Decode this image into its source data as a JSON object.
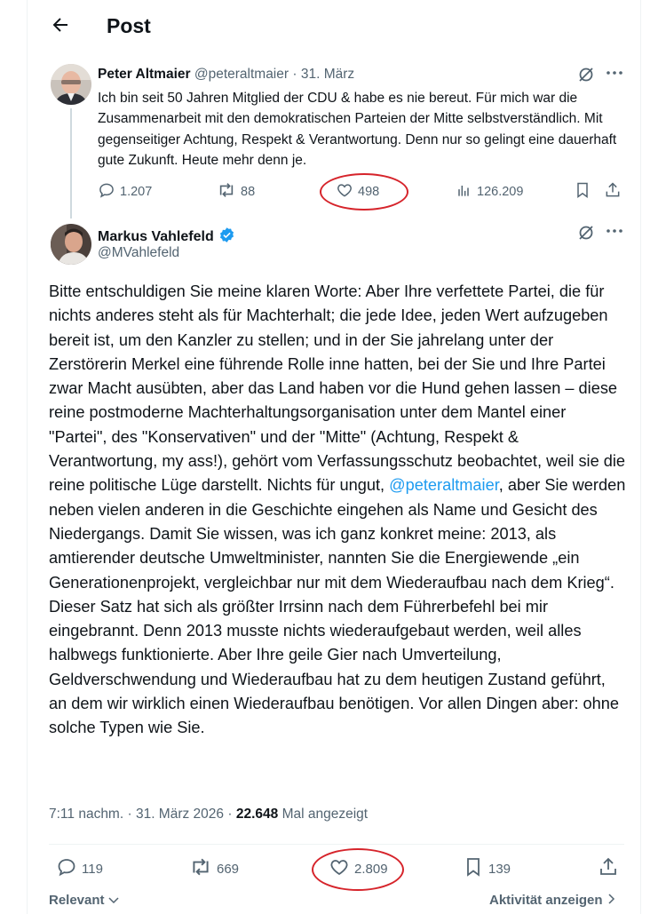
{
  "header": {
    "back_icon": "arrow-left-icon",
    "title": "Post"
  },
  "parent_post": {
    "author_name": "Peter Altmaier",
    "handle": "@peteraltmaier",
    "separator": "·",
    "date": "31. März",
    "text": "Ich bin seit 50 Jahren Mitglied der CDU & habe es nie bereut.  Für mich war die Zusammenarbeit mit den demokratischen Parteien der Mitte selbstverständlich. Mit gegenseitiger Achtung, Respekt & Verantwortung. Denn nur so gelingt eine dauerhaft gute Zukunft. Heute mehr denn je.",
    "replies": "1.207",
    "reposts": "88",
    "likes": "498",
    "views": "126.209"
  },
  "main_post": {
    "author_name": "Markus Vahlefeld",
    "handle": "@MVahlefeld",
    "text_before_mention": "Bitte entschuldigen Sie meine klaren Worte: Aber Ihre verfettete Partei, die für nichts anderes steht als für Machterhalt; die jede Idee, jeden Wert aufzugeben bereit ist, um den Kanzler zu stellen; und in der Sie jahrelang unter der Zerstörerin Merkel eine führende Rolle inne hatten, bei der Sie und Ihre Partei zwar Macht ausübten, aber das Land haben vor die Hund gehen lassen – diese reine postmoderne Machterhaltungsorganisation unter dem Mantel einer \"Partei\", des \"Konservativen\" und der \"Mitte\" (Achtung, Respekt & Verantwortung, my ass!), gehört vom Verfassungsschutz beobachtet, weil sie die reine politische Lüge darstellt. Nichts für ungut, ",
    "mention": "@peteraltmaier",
    "text_after_mention": ", aber Sie werden neben vielen anderen in die Geschichte eingehen als Name und Gesicht des Niedergangs. Damit Sie wissen, was ich ganz konkret meine: 2013, als amtierender deutsche Umweltminister, nannten Sie die Energiewende „ein Generationenprojekt, vergleichbar nur mit dem Wiederaufbau nach dem Krieg“.  Dieser Satz hat sich als größter Irrsinn nach dem Führerbefehl bei mir eingebrannt. Denn 2013 musste nichts wiederaufgebaut werden, weil alles halbwegs funktionierte. Aber Ihre geile Gier nach Umverteilung, Geldverschwendung und Wiederaufbau hat zu dem heutigen Zustand geführt, an dem wir wirklich einen Wiederaufbau benötigen. Vor allen Dingen aber: ohne solche Typen wie Sie.",
    "time": "7:11 nachm.",
    "separator": "·",
    "date": "31. März 2026",
    "views": "22.648",
    "views_label": "Mal angezeigt",
    "replies": "119",
    "reposts": "669",
    "likes": "2.809",
    "bookmarks": "139"
  },
  "footer": {
    "sort_label": "Relevant",
    "activity_label": "Aktivität anzeigen"
  },
  "colors": {
    "accent": "#1d9bf0",
    "muted": "#536471",
    "highlight": "#d6242b"
  }
}
